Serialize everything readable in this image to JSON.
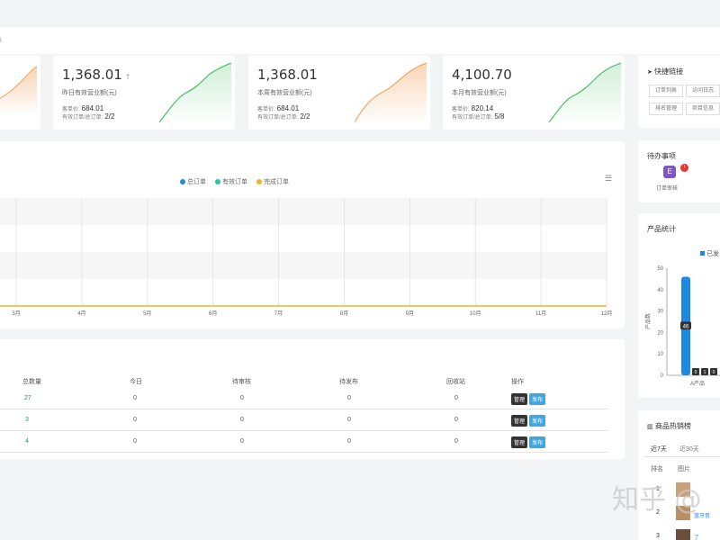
{
  "breadcrumb": "i",
  "stats": [
    {
      "value": "",
      "label": "",
      "spark_color": "#f4a460"
    },
    {
      "value": "1,368.01",
      "up": "↑",
      "label": "昨日有效营业额(元)",
      "avg_label": "客单价:",
      "avg": "684.01",
      "orders_label": "有效订单/总订单:",
      "orders": "2/2",
      "spark_color": "#43c15e"
    },
    {
      "value": "1,368.01",
      "up": "",
      "label": "本周有效营业额(元)",
      "avg_label": "客单价:",
      "avg": "684.01",
      "orders_label": "有效订单/总订单:",
      "orders": "2/2",
      "spark_color": "#f4a460"
    },
    {
      "value": "4,100.70",
      "up": "",
      "label": "本月有效营业额(元)",
      "avg_label": "客单价:",
      "avg": "820.14",
      "orders_label": "有效订单/总订单:",
      "orders": "5/8",
      "spark_color": "#43c15e"
    }
  ],
  "order_chart": {
    "legend": [
      {
        "name": "总订单",
        "color": "#1e88e5"
      },
      {
        "name": "有效订单",
        "color": "#26c6a0"
      },
      {
        "name": "完成订单",
        "color": "#f0b429"
      }
    ],
    "months": [
      "3月",
      "4月",
      "5月",
      "6月",
      "7月",
      "8月",
      "9月",
      "10月",
      "11月",
      "12月"
    ]
  },
  "table": {
    "headers": [
      "总数量",
      "今日",
      "待审核",
      "待发布",
      "回收站",
      "操作"
    ],
    "rows": [
      [
        "27",
        "0",
        "0",
        "0",
        "0"
      ],
      [
        "3",
        "0",
        "0",
        "0",
        "0"
      ],
      [
        "4",
        "0",
        "0",
        "0",
        "0"
      ]
    ],
    "btn_manage": "管理",
    "btn_publish": "发布"
  },
  "quick_links": {
    "title": "快捷链接",
    "items": [
      "订单列表",
      "访问日志",
      "排名管理",
      "项目信息"
    ]
  },
  "todo": {
    "title": "待办事项",
    "item_label": "订单审核",
    "badge": "!"
  },
  "product_stats": {
    "title": "产品统计",
    "legend": "已发",
    "ylabel": "产品数",
    "yticks": [
      "50",
      "40",
      "30",
      "20",
      "10",
      "0"
    ],
    "bar_value": "46",
    "small_labels": [
      "0",
      "1",
      "0"
    ],
    "category": "A产品"
  },
  "hot_sales": {
    "title": "商品热销榜",
    "tabs": [
      "近7天",
      "近30天"
    ],
    "cols": [
      "排名",
      "图片"
    ],
    "ranks": [
      "1",
      "2",
      "3"
    ],
    "names": [
      "",
      "蓝牙音",
      "了"
    ]
  },
  "watermark": "知乎 @"
}
